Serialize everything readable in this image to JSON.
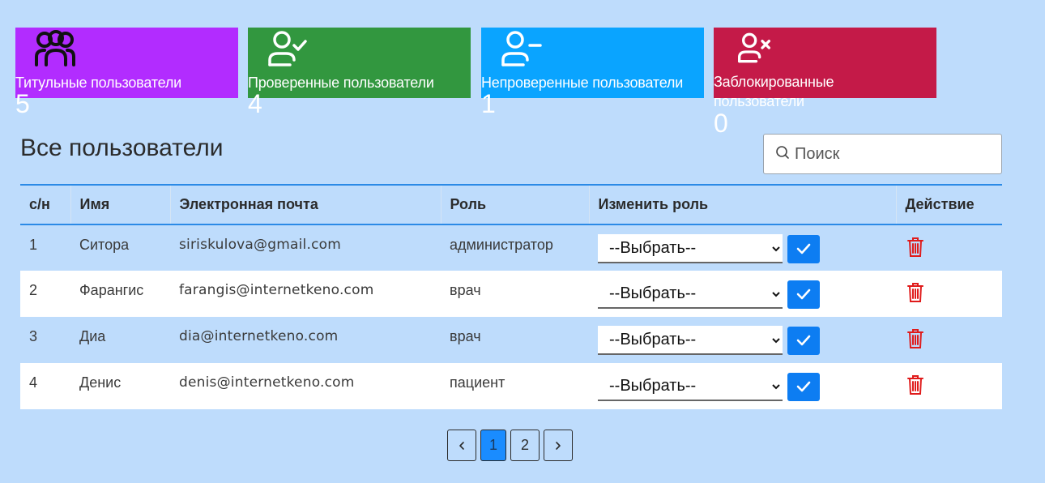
{
  "cards": [
    {
      "label": "Титульные пользователи",
      "count": "5",
      "color": "#b22cff",
      "icon": "users-group-icon"
    },
    {
      "label": "Проверенные пользователи",
      "count": "4",
      "color": "#32973f",
      "icon": "user-check-icon"
    },
    {
      "label": "Непроверенные пользователи",
      "count": "1",
      "color": "#0aa4ff",
      "icon": "user-minus-icon"
    },
    {
      "label": "Заблокированные пользователи",
      "count": "0",
      "color": "#c41a48",
      "icon": "user-x-icon"
    }
  ],
  "page_title": "Все пользователи",
  "search": {
    "placeholder": "Поиск",
    "value": ""
  },
  "table": {
    "headers": [
      "с/н",
      "Имя",
      "Электронная почта",
      "Роль",
      "Изменить роль",
      "Действие"
    ],
    "rows": [
      {
        "sn": "1",
        "name": "Ситора",
        "email": "siriskulova@gmail.com",
        "role": "администратор",
        "select": "--Выбрать--"
      },
      {
        "sn": "2",
        "name": "Фарангис",
        "email": "farangis@internetkeno.com",
        "role": "врач",
        "select": "--Выбрать--"
      },
      {
        "sn": "3",
        "name": "Диа",
        "email": "dia@internetkeno.com",
        "role": "врач",
        "select": "--Выбрать--"
      },
      {
        "sn": "4",
        "name": "Денис",
        "email": "denis@internetkeno.com",
        "role": "пациент",
        "select": "--Выбрать--"
      }
    ]
  },
  "pagination": {
    "pages": [
      "1",
      "2"
    ],
    "current": "1"
  },
  "colors": {
    "accent": "#0d7df2",
    "delete": "#e01b1b",
    "background": "#bedcfc"
  }
}
